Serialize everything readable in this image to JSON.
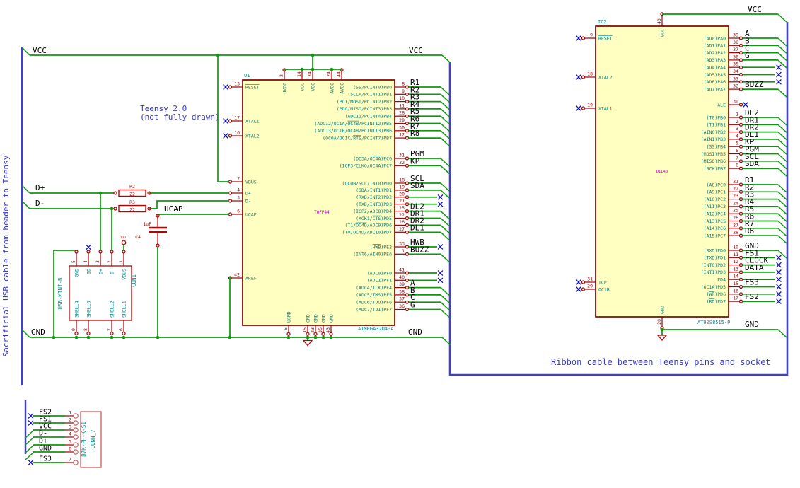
{
  "notes": {
    "left_cable_note": "Sacrificial USB cable from header to Teensy",
    "teensy_note_line1": "Teensy 2.0",
    "teensy_note_line2": "(not fully drawn)",
    "ribbon_note": "Ribbon cable between Teensy pins and socket"
  },
  "net_labels": {
    "vcc": "VCC",
    "gnd": "GND",
    "dplus": "D+",
    "dminus": "D-",
    "ucap": "UCAP"
  },
  "colors": {
    "wire": "#0c9a0c",
    "component": "#bf0000",
    "pin": "#a00000",
    "ic_fill": "#FFFFC2",
    "ic_border": "#840000",
    "pin_name": "#008080",
    "field": "#0b8a8a",
    "footprint": "#c000c0",
    "label": "#000000",
    "note": "#3535cf",
    "bus": "#4040cc",
    "noconnect": "#0b0bc4",
    "conn_box": "#cf5c5c"
  },
  "u1": {
    "ref": "U1",
    "value": "ATMEGA32U4-A",
    "footprint": "TQFP44",
    "top_pins": [
      {
        "num": "2",
        "name": "UVCC"
      },
      {
        "num": "14",
        "name": "VCC"
      },
      {
        "num": "34",
        "name": "VCC"
      },
      {
        "num": "24",
        "name": "AVCC"
      },
      {
        "num": "44",
        "name": "AVCC"
      }
    ],
    "bottom_pins": [
      {
        "num": "5",
        "name": "UGND"
      },
      {
        "num": "15",
        "name": "GND"
      },
      {
        "num": "23",
        "name": "GND"
      },
      {
        "num": "35",
        "name": "GND"
      },
      {
        "num": "43",
        "name": "GND"
      }
    ],
    "left_pins": [
      {
        "num": "13",
        "name": "~RESET~",
        "nc": true
      },
      {
        "num": "17",
        "name": "XTAL1",
        "nc": true
      },
      {
        "num": "16",
        "name": "XTAL2",
        "nc": true
      },
      {
        "num": "7",
        "name": "VBUS"
      },
      {
        "num": "4",
        "name": "D+"
      },
      {
        "num": "3",
        "name": "D-"
      },
      {
        "num": "6",
        "name": "UCAP"
      },
      {
        "num": "42",
        "name": "AREF"
      }
    ],
    "right_groups": [
      [
        {
          "num": "8",
          "name": "(SS/PCINT0)PB0",
          "net": "R1"
        },
        {
          "num": "9",
          "name": "(SCLK/PCINT1)PB1",
          "net": "R2"
        },
        {
          "num": "10",
          "name": "(PDI/MOSI/PCINT2)PB2",
          "net": "R3"
        },
        {
          "num": "11",
          "name": "(PDO/MISO/PCINT3)PB3",
          "net": "R4"
        },
        {
          "num": "28",
          "name": "(ADC11/PCINT4)PB4",
          "net": "R5"
        },
        {
          "num": "29",
          "name": "(ADC12/OC1A/~OC4B~/PCINT12)PB5",
          "net": "R6"
        },
        {
          "num": "30",
          "name": "(ADC13/OC1B/OC4B/PCINT13)PB6",
          "net": "R7"
        },
        {
          "num": "12",
          "name": "(OC0A/OC1C/~RTS~/PCINT7)PB7",
          "net": "R8"
        }
      ],
      [
        {
          "num": "31",
          "name": "(OC3A/~OC4A~)PC6",
          "net": "PGM"
        },
        {
          "num": "32",
          "name": "(ICP3/CLKO/OC4A)PC7",
          "net": "KP"
        }
      ],
      [
        {
          "num": "18",
          "name": "(OC0B/SCL/INT0)PD0",
          "net": "SCL"
        },
        {
          "num": "19",
          "name": "(SDA/INT1)PD1",
          "net": "SDA"
        },
        {
          "num": "20",
          "name": "(RXD/INT2)PD2",
          "net": "",
          "nc": true
        },
        {
          "num": "21",
          "name": "(TXD/INT3)PD3",
          "net": "",
          "nc": true
        },
        {
          "num": "25",
          "name": "(ICP2/ADC8)PD4",
          "net": "DL2"
        },
        {
          "num": "22",
          "name": "(XCK1/~CTS~)PD5",
          "net": "DR1"
        },
        {
          "num": "26",
          "name": "(T1/~OC4D~/ADC9)PD6",
          "net": "DR2"
        },
        {
          "num": "27",
          "name": "(T0/OC4D/ADC10)PD7",
          "net": "DL1"
        }
      ],
      [
        {
          "num": "33",
          "name": "(~HWB~)PE2",
          "net": "HWB",
          "nc": true
        },
        {
          "num": "1",
          "name": "(INT6/AIN0)PE6",
          "net": "BUZZ"
        }
      ],
      [
        {
          "num": "41",
          "name": "(ADC0)PF0",
          "net": "",
          "nc": true
        },
        {
          "num": "40",
          "name": "(ADC1)PF1",
          "net": "",
          "nc": true
        },
        {
          "num": "39",
          "name": "(ADC4/TCK)PF4",
          "net": "A"
        },
        {
          "num": "38",
          "name": "(ADC5/TMS)PF5",
          "net": "B"
        },
        {
          "num": "37",
          "name": "(ADC6/TDO)PF6",
          "net": "C"
        },
        {
          "num": "36",
          "name": "(ADC7/TDI)PF7",
          "net": "G"
        }
      ]
    ]
  },
  "ic2": {
    "ref": "IC2",
    "value": "AT90S8515-P",
    "footprint": "DIL40",
    "top_pins": [
      {
        "num": "40",
        "name": "VCC"
      }
    ],
    "bottom_pins": [
      {
        "num": "20",
        "name": "GND"
      }
    ],
    "left_pins": [
      {
        "num": "9",
        "name": "~RESET~",
        "nc": true
      },
      {
        "num": "18",
        "name": "XTAL2",
        "nc": true
      },
      {
        "num": "19",
        "name": "XTAL1",
        "nc": true
      },
      {
        "num": "31",
        "name": "ICP",
        "nc": true
      },
      {
        "num": "29",
        "name": "OC1B",
        "nc": true
      }
    ],
    "right_groups": [
      [
        {
          "num": "39",
          "name": "(AD0)PA0",
          "net": "A"
        },
        {
          "num": "38",
          "name": "(AD1)PA1",
          "net": "B"
        },
        {
          "num": "37",
          "name": "(AD2)PA2",
          "net": "C"
        },
        {
          "num": "36",
          "name": "(AD3)PA3",
          "net": "G"
        },
        {
          "num": "35",
          "name": "(AD4)PA4",
          "net": "",
          "nc": true
        },
        {
          "num": "34",
          "name": "(AD5)PA5",
          "net": "",
          "nc": true
        },
        {
          "num": "33",
          "name": "(AD6)PA6",
          "net": "",
          "nc": true
        },
        {
          "num": "32",
          "name": "(AD7)PA7",
          "net": "BUZZ"
        }
      ],
      [
        {
          "num": "30",
          "name": "ALE",
          "net": "",
          "nc_at_pin": true
        }
      ],
      [
        {
          "num": "1",
          "name": "(T0)PB0",
          "net": "DL2"
        },
        {
          "num": "2",
          "name": "(T1)PB1",
          "net": "DR1"
        },
        {
          "num": "3",
          "name": "(AIN0)PB2",
          "net": "DR2"
        },
        {
          "num": "4",
          "name": "(AIN1)PB3",
          "net": "DL1"
        },
        {
          "num": "5",
          "name": "(~SS~)PB4",
          "net": "KP"
        },
        {
          "num": "6",
          "name": "(MOSI)PB5",
          "net": "PGM"
        },
        {
          "num": "7",
          "name": "(MISO)PB6",
          "net": "SCL"
        },
        {
          "num": "8",
          "name": "(SCK)PB7",
          "net": "SDA"
        }
      ],
      [
        {
          "num": "21",
          "name": "(A8)PC0",
          "net": "R1"
        },
        {
          "num": "22",
          "name": "(A9)PC1",
          "net": "R2"
        },
        {
          "num": "23",
          "name": "(A10)PC2",
          "net": "R3"
        },
        {
          "num": "24",
          "name": "(A11)PC3",
          "net": "R4"
        },
        {
          "num": "25",
          "name": "(A12)PC4",
          "net": "R5"
        },
        {
          "num": "26",
          "name": "(A13)PC5",
          "net": "R6"
        },
        {
          "num": "27",
          "name": "(A14)PC6",
          "net": "R7"
        },
        {
          "num": "28",
          "name": "(A15)PC7",
          "net": "R8"
        }
      ],
      [
        {
          "num": "10",
          "name": "(RXD)PD0",
          "net": "GND"
        },
        {
          "num": "11",
          "name": "(TXD)PD1",
          "net": "FS1",
          "nc": true
        },
        {
          "num": "12",
          "name": "(INT0)PD2",
          "net": "CLOCK",
          "nc": true
        },
        {
          "num": "13",
          "name": "(INT1)PD3",
          "net": "DATA",
          "nc": true
        },
        {
          "num": "14",
          "name": "PD4",
          "net": "",
          "nc": true
        },
        {
          "num": "15",
          "name": "(OC1A)PD5",
          "net": "FS3",
          "nc": true
        },
        {
          "num": "16",
          "name": "(~WR~)PD6",
          "net": "",
          "nc": true
        },
        {
          "num": "17",
          "name": "(~RD~)PD7",
          "net": "FS2",
          "nc": true
        }
      ]
    ]
  },
  "con1": {
    "ref": "CON1",
    "value": "USB-MINI-B",
    "top_pins": [
      {
        "num": "5",
        "name": "GND"
      },
      {
        "num": "4",
        "name": "ID",
        "nc": true
      },
      {
        "num": "3",
        "name": "D+"
      },
      {
        "num": "2",
        "name": "D-"
      },
      {
        "num": "1",
        "name": "VBUS"
      }
    ],
    "bottom_pins": [
      {
        "num": "9",
        "name": "SHELL4"
      },
      {
        "num": "8",
        "name": "SHELL3"
      },
      {
        "num": "7",
        "name": "SHELL2"
      },
      {
        "num": "6",
        "name": "SHELL1"
      }
    ]
  },
  "conn7": {
    "ref": "CONN_7",
    "value": "B7K-PH-K-S1",
    "pins": [
      {
        "num": "1",
        "net": "FS2",
        "nc": true
      },
      {
        "num": "2",
        "net": "FS1",
        "nc": true
      },
      {
        "num": "3",
        "net": "VCC"
      },
      {
        "num": "4",
        "net": "D-"
      },
      {
        "num": "5",
        "net": "D+"
      },
      {
        "num": "6",
        "net": "GND"
      },
      {
        "num": "7",
        "net": "FS3",
        "nc": true
      }
    ]
  },
  "resistors": {
    "r2": {
      "ref": "R2",
      "value": "22"
    },
    "r3": {
      "ref": "R3",
      "value": "22"
    }
  },
  "capacitor": {
    "ref": "C4",
    "value": "1uF"
  }
}
